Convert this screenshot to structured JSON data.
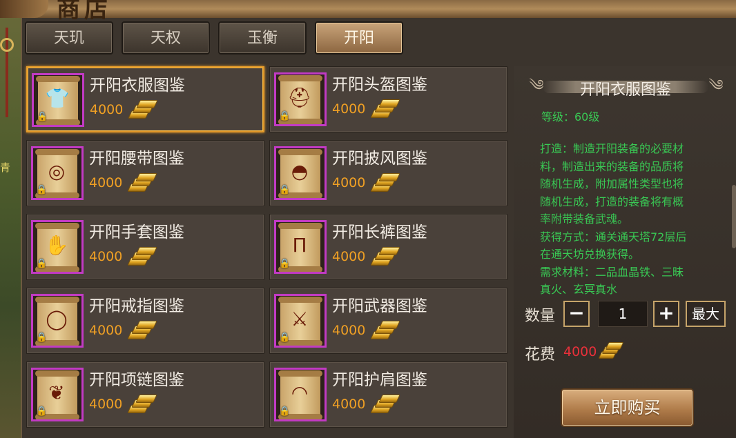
{
  "window": {
    "title": "商店",
    "side_glyph": "青"
  },
  "tabs": [
    {
      "label": "天玑",
      "active": false
    },
    {
      "label": "天权",
      "active": false
    },
    {
      "label": "玉衡",
      "active": false
    },
    {
      "label": "开阳",
      "active": true
    }
  ],
  "items": [
    {
      "name": "开阳衣服图鉴",
      "price": "4000",
      "icon": "armor-icon",
      "glyph": "👕",
      "selected": true
    },
    {
      "name": "开阳头盔图鉴",
      "price": "4000",
      "icon": "helmet-icon",
      "glyph": "⛑"
    },
    {
      "name": "开阳腰带图鉴",
      "price": "4000",
      "icon": "belt-icon",
      "glyph": "◎"
    },
    {
      "name": "开阳披风图鉴",
      "price": "4000",
      "icon": "cape-icon",
      "glyph": "◓"
    },
    {
      "name": "开阳手套图鉴",
      "price": "4000",
      "icon": "gloves-icon",
      "glyph": "✋"
    },
    {
      "name": "开阳长裤图鉴",
      "price": "4000",
      "icon": "pants-icon",
      "glyph": "Π"
    },
    {
      "name": "开阳戒指图鉴",
      "price": "4000",
      "icon": "ring-icon",
      "glyph": "◯"
    },
    {
      "name": "开阳武器图鉴",
      "price": "4000",
      "icon": "weapon-icon",
      "glyph": "⚔"
    },
    {
      "name": "开阳项链图鉴",
      "price": "4000",
      "icon": "necklace-icon",
      "glyph": "❦"
    },
    {
      "name": "开阳护肩图鉴",
      "price": "4000",
      "icon": "shoulder-icon",
      "glyph": "◠"
    }
  ],
  "detail": {
    "title": "开阳衣服图鉴",
    "level": "等级：60级",
    "desc_lines": [
      "打造：制造开阳装备的必要材",
      "料，制造出来的装备的品质将",
      "随机生成，附加属性类型也将",
      "随机生成，打造的装备将有概",
      "率附带装备武魂。",
      "获得方式：通关通天塔72层后",
      "在通天坊兑换获得。",
      "需求材料：二品血晶铁、三昧",
      "真火、玄冥真水"
    ],
    "quantity_label": "数量",
    "quantity_value": "1",
    "minus_label": "−",
    "plus_label": "+",
    "max_label": "最大",
    "cost_label": "花费",
    "cost_value": "4000",
    "buy_label": "立即购买"
  },
  "colors": {
    "accent_green": "#39c854",
    "price_orange": "#f0a024",
    "cost_red": "#e8303a",
    "selected_border": "#e39a2a",
    "icon_border": "#c23ac4"
  }
}
